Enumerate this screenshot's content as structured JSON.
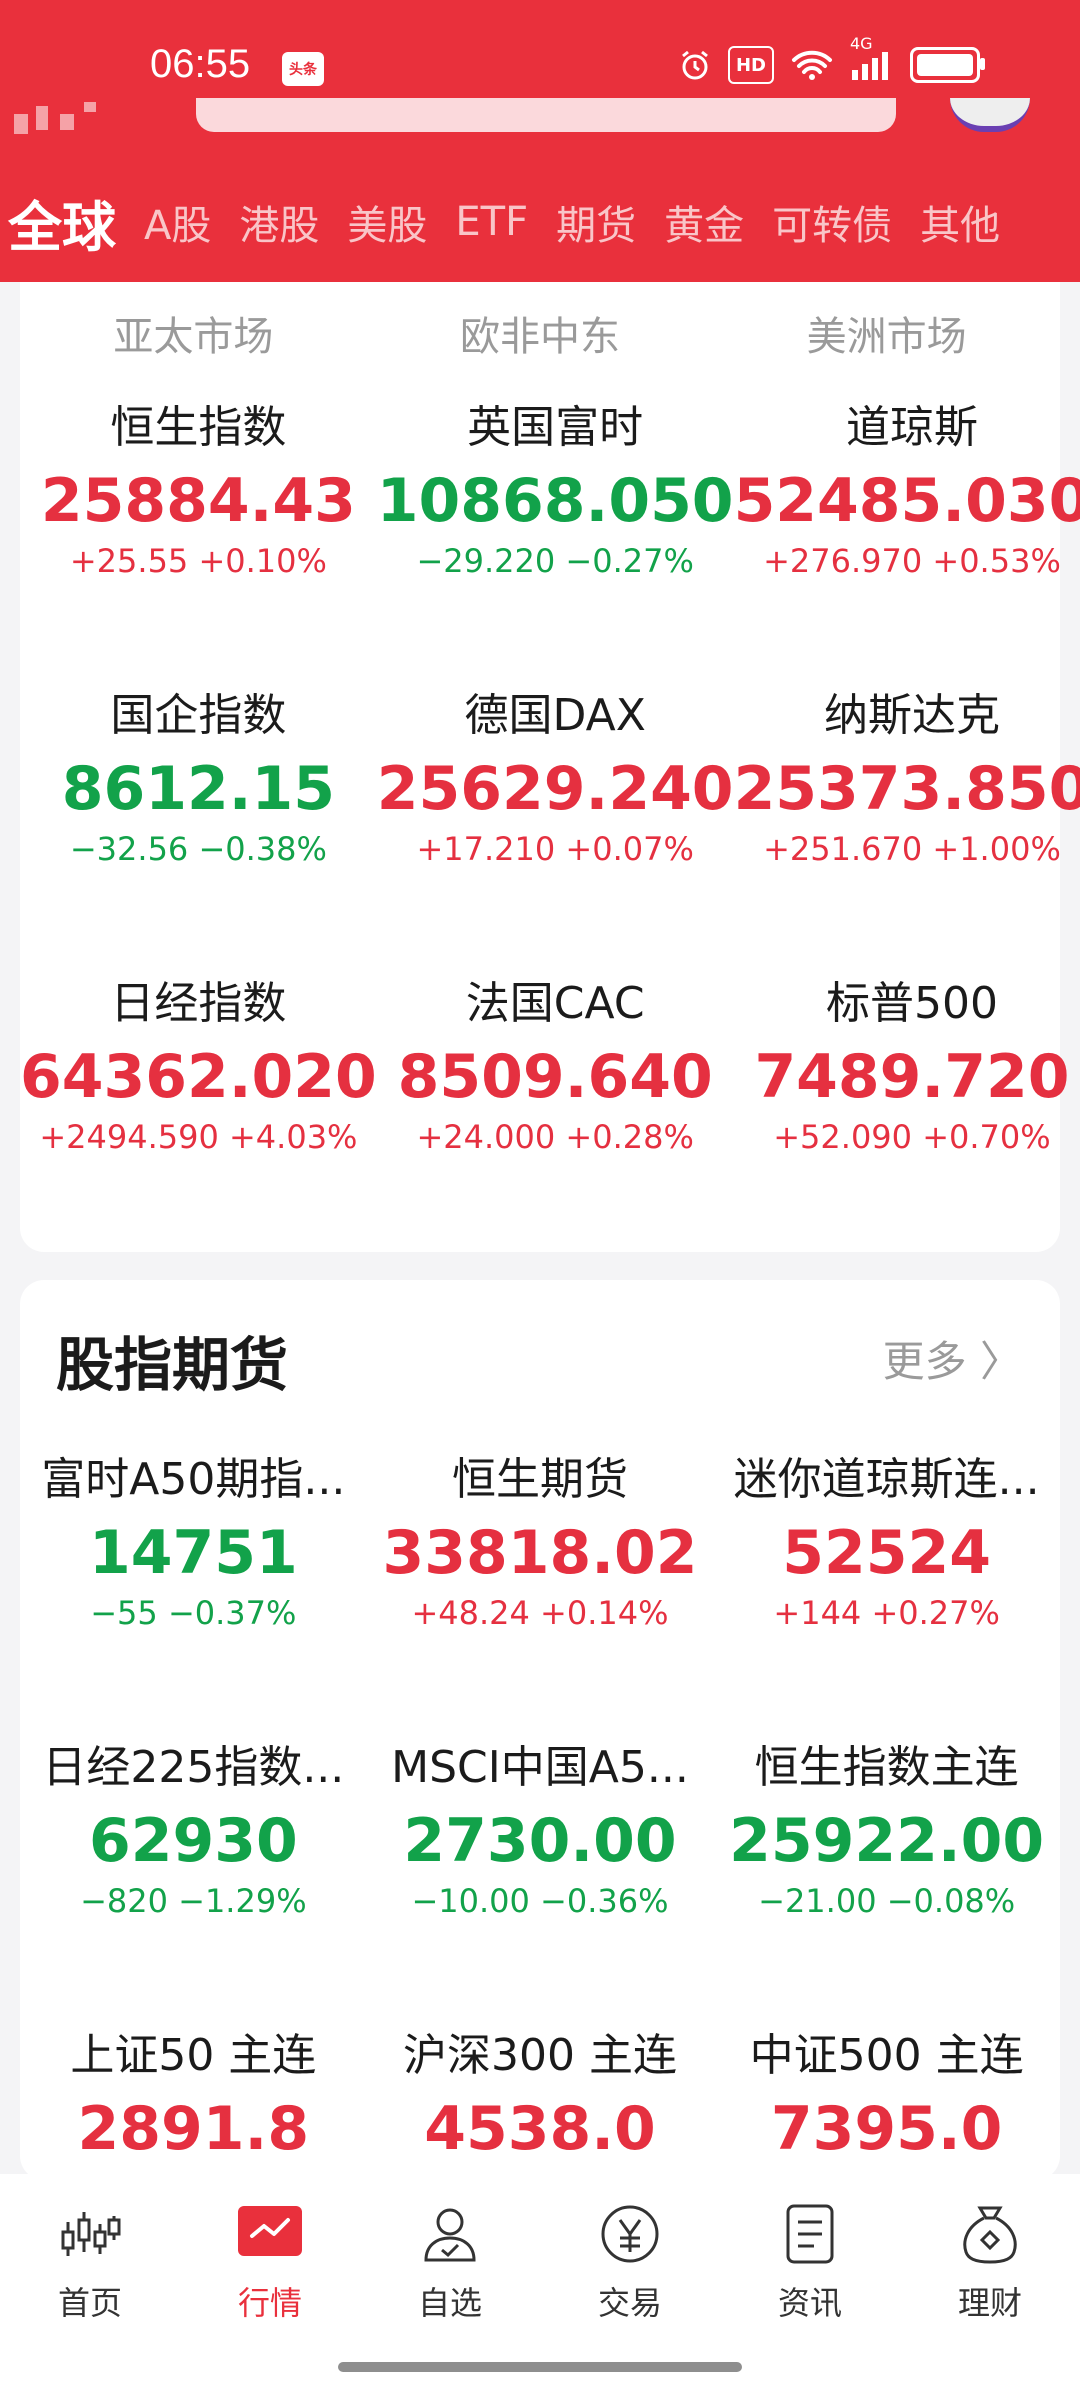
{
  "status_bar": {
    "time": "06:55",
    "app_badge": "头条",
    "hd": "HD",
    "net": "4G"
  },
  "tabs": [
    "全球",
    "A股",
    "港股",
    "美股",
    "ETF",
    "期货",
    "黄金",
    "可转债",
    "其他"
  ],
  "regions": [
    "亚太市场",
    "欧非中东",
    "美洲市场"
  ],
  "indices": [
    {
      "name": "恒生指数",
      "value": "25884.43",
      "change": "+25.55  +0.10%",
      "trend": "up"
    },
    {
      "name": "英国富时",
      "value": "10868.050",
      "change": "−29.220  −0.27%",
      "trend": "down"
    },
    {
      "name": "道琼斯",
      "value": "52485.030",
      "change": "+276.970  +0.53%",
      "trend": "up"
    },
    {
      "name": "国企指数",
      "value": "8612.15",
      "change": "−32.56  −0.38%",
      "trend": "down"
    },
    {
      "name": "德国DAX",
      "value": "25629.240",
      "change": "+17.210  +0.07%",
      "trend": "up"
    },
    {
      "name": "纳斯达克",
      "value": "25373.850",
      "change": "+251.670  +1.00%",
      "trend": "up"
    },
    {
      "name": "日经指数",
      "value": "64362.020",
      "change": "+2494.590  +4.03%",
      "trend": "up"
    },
    {
      "name": "法国CAC",
      "value": "8509.640",
      "change": "+24.000  +0.28%",
      "trend": "up"
    },
    {
      "name": "标普500",
      "value": "7489.720",
      "change": "+52.090  +0.70%",
      "trend": "up"
    }
  ],
  "futures_section": {
    "title": "股指期货",
    "more": "更多 〉"
  },
  "futures": [
    {
      "name": "富时A50期指...",
      "value": "14751",
      "change": "−55  −0.37%",
      "trend": "down"
    },
    {
      "name": "恒生期货",
      "value": "33818.02",
      "change": "+48.24  +0.14%",
      "trend": "up"
    },
    {
      "name": "迷你道琼斯连...",
      "value": "52524",
      "change": "+144  +0.27%",
      "trend": "up"
    },
    {
      "name": "日经225指数...",
      "value": "62930",
      "change": "−820  −1.29%",
      "trend": "down"
    },
    {
      "name": "MSCI中国A5...",
      "value": "2730.00",
      "change": "−10.00  −0.36%",
      "trend": "down"
    },
    {
      "name": "恒生指数主连",
      "value": "25922.00",
      "change": "−21.00  −0.08%",
      "trend": "down"
    },
    {
      "name": "上证50 主连",
      "value": "2891.8",
      "change": "",
      "trend": "up"
    },
    {
      "name": "沪深300 主连",
      "value": "4538.0",
      "change": "",
      "trend": "up"
    },
    {
      "name": "中证500 主连",
      "value": "7395.0",
      "change": "",
      "trend": "up"
    }
  ],
  "bottom_nav": [
    {
      "label": "首页",
      "icon": "candlestick-icon"
    },
    {
      "label": "行情",
      "icon": "market-chart-icon"
    },
    {
      "label": "自选",
      "icon": "user-check-icon"
    },
    {
      "label": "交易",
      "icon": "yen-coin-icon"
    },
    {
      "label": "资讯",
      "icon": "news-document-icon"
    },
    {
      "label": "理财",
      "icon": "money-bag-icon"
    }
  ],
  "colors": {
    "brand": "#e9303c",
    "up": "#e53040",
    "down": "#12a24a"
  }
}
